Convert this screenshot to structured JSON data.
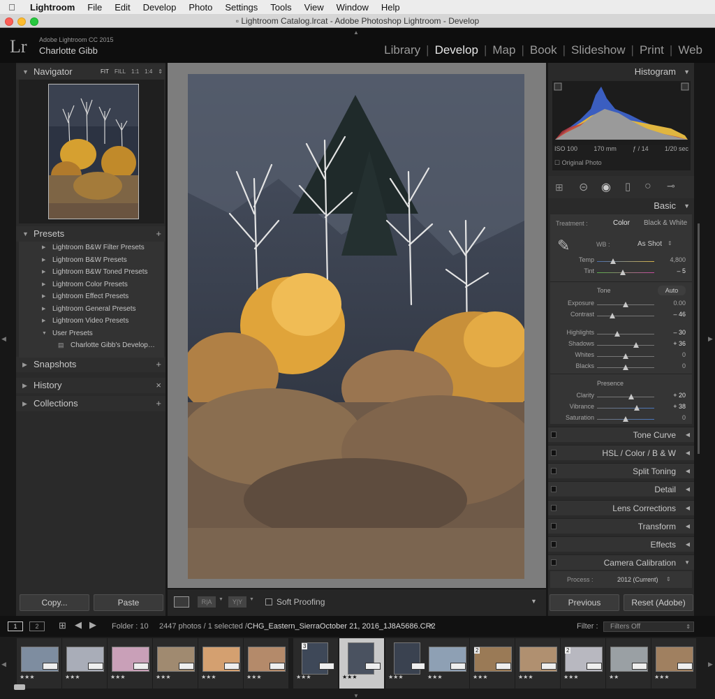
{
  "menubar": {
    "app": "Lightroom",
    "items": [
      "File",
      "Edit",
      "Develop",
      "Photo",
      "Settings",
      "Tools",
      "View",
      "Window",
      "Help"
    ]
  },
  "window": {
    "title": "Lightroom Catalog.lrcat - Adobe Photoshop Lightroom - Develop"
  },
  "identity": {
    "logo": "Lr",
    "version": "Adobe Lightroom CC 2015",
    "user": "Charlotte Gibb"
  },
  "modules": [
    "Library",
    "Develop",
    "Map",
    "Book",
    "Slideshow",
    "Print",
    "Web"
  ],
  "active_module": "Develop",
  "left": {
    "navigator": {
      "title": "Navigator",
      "opts": [
        "FIT",
        "FILL",
        "1:1",
        "1:4"
      ]
    },
    "presets": {
      "title": "Presets",
      "items": [
        "Lightroom B&W Filter Presets",
        "Lightroom B&W Presets",
        "Lightroom B&W Toned Presets",
        "Lightroom Color Presets",
        "Lightroom Effect Presets",
        "Lightroom General Presets",
        "Lightroom Video Presets",
        "User Presets"
      ],
      "user_child": "Charlotte Gibb's Develop…"
    },
    "snapshots": "Snapshots",
    "history": "History",
    "collections": "Collections",
    "copy_label": "Copy...",
    "paste_label": "Paste"
  },
  "toolbar": {
    "soft_proofing": "Soft Proofing"
  },
  "right": {
    "histogram": {
      "title": "Histogram",
      "iso": "ISO 100",
      "focal": "170 mm",
      "aperture": "ƒ / 14",
      "shutter": "1/20 sec",
      "original": "Original Photo"
    },
    "basic": {
      "title": "Basic",
      "treatment": "Treatment :",
      "color": "Color",
      "bw": "Black & White",
      "wb_label": "WB :",
      "wb_value": "As Shot",
      "tone_label": "Tone",
      "auto": "Auto",
      "presence_label": "Presence",
      "sliders": [
        {
          "label": "Temp",
          "value": "4,800",
          "pos": 0.28
        },
        {
          "label": "Tint",
          "value": "– 5",
          "pos": 0.45
        },
        {
          "label": "Exposure",
          "value": "0.00",
          "pos": 0.5
        },
        {
          "label": "Contrast",
          "value": "– 46",
          "pos": 0.27
        },
        {
          "label": "Highlights",
          "value": "– 30",
          "pos": 0.35
        },
        {
          "label": "Shadows",
          "value": "+ 36",
          "pos": 0.68
        },
        {
          "label": "Whites",
          "value": "0",
          "pos": 0.5
        },
        {
          "label": "Blacks",
          "value": "0",
          "pos": 0.5
        },
        {
          "label": "Clarity",
          "value": "+ 20",
          "pos": 0.6
        },
        {
          "label": "Vibrance",
          "value": "+ 38",
          "pos": 0.69
        },
        {
          "label": "Saturation",
          "value": "0",
          "pos": 0.5
        }
      ]
    },
    "panels": [
      "Tone Curve",
      "HSL / Color / B & W",
      "Split Toning",
      "Detail",
      "Lens Corrections",
      "Transform",
      "Effects",
      "Camera Calibration"
    ],
    "process_label": "Process :",
    "process_value": "2012 (Current)",
    "previous": "Previous",
    "reset": "Reset (Adobe)"
  },
  "filmbar": {
    "page1": "1",
    "page2": "2",
    "folder": "Folder : 10",
    "count": "2447 photos / 1 selected /",
    "file": "CHG_Eastern_SierraOctober 21, 2016_1J8A5686.CR2",
    "filter_label": "Filter :",
    "filter_value": "Filters Off"
  },
  "filmstrip": [
    {
      "stars": "★★★",
      "count": ""
    },
    {
      "stars": "★★★",
      "count": ""
    },
    {
      "stars": "★★★",
      "count": ""
    },
    {
      "stars": "★★★",
      "count": ""
    },
    {
      "stars": "★★★",
      "count": ""
    },
    {
      "stars": "★★★",
      "count": ""
    },
    {
      "stars": "★★★",
      "count": "3"
    },
    {
      "stars": "★★★",
      "count": ""
    },
    {
      "stars": "★★★",
      "count": ""
    },
    {
      "stars": "★★★",
      "count": ""
    },
    {
      "stars": "★★★",
      "count": "2"
    },
    {
      "stars": "★★★",
      "count": ""
    },
    {
      "stars": "★★★",
      "count": "2"
    },
    {
      "stars": "★★",
      "count": ""
    },
    {
      "stars": "★★★",
      "count": ""
    }
  ],
  "colors": {
    "accent": "#e6e6e6",
    "panel": "#2a2a2a",
    "background": "#171717"
  }
}
